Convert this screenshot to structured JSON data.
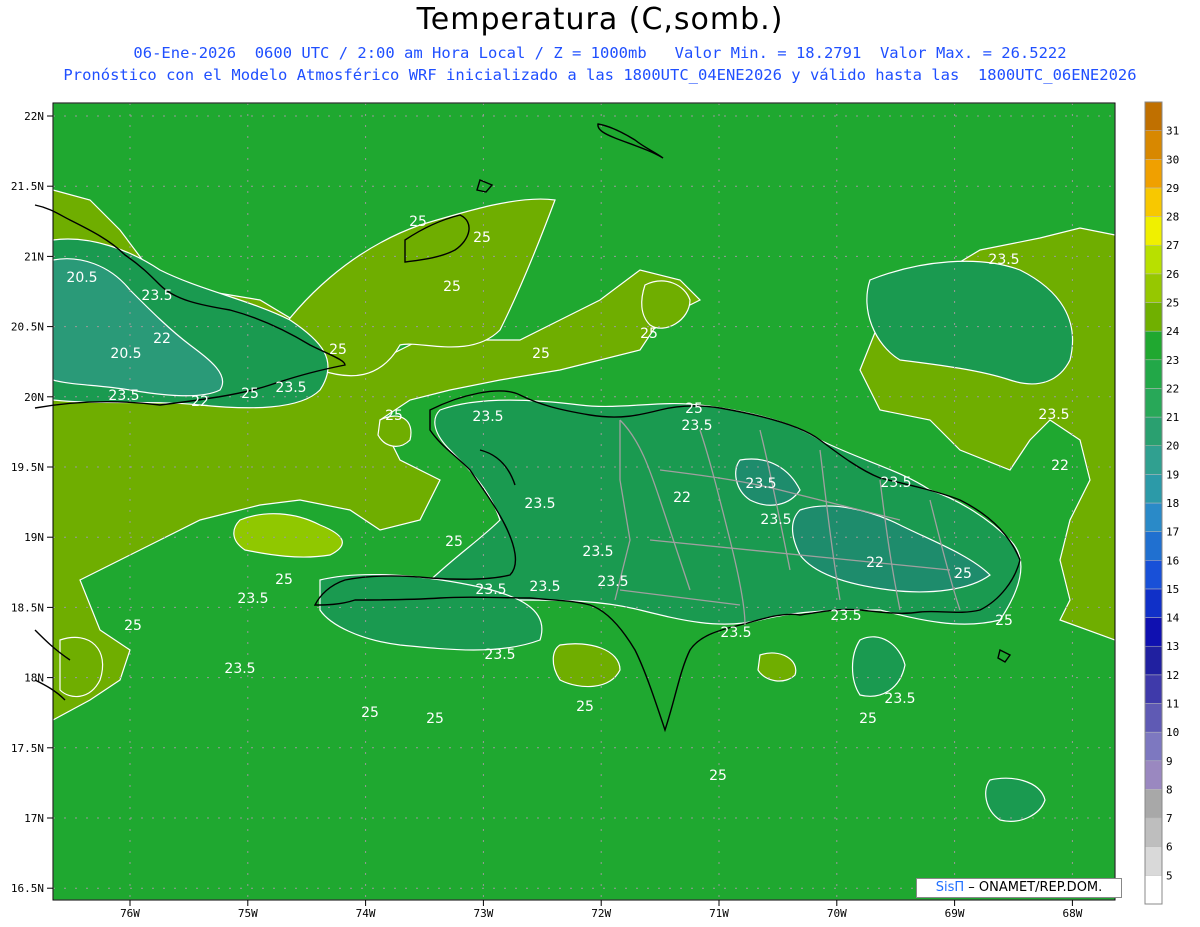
{
  "title": "Temperatura (C,somb.)",
  "subtitle_line1": "06-Ene-2026  0600 UTC / 2:00 am Hora Local / Z = 1000mb   Valor Min. = 18.2791  Valor Max. = 26.5222",
  "subtitle_line2": "Pronóstico con el Modelo Atmosférico WRF inicializado a las 1800UTC_04ENE2026 y válido hasta las  1800UTC_06ENE2026",
  "lat_labels": [
    "22N",
    "21.5N",
    "21N",
    "20.5N",
    "20N",
    "19.5N",
    "19N",
    "18.5N",
    "18N",
    "17.5N",
    "17N",
    "16.5N"
  ],
  "lon_labels": [
    "76W",
    "75W",
    "74W",
    "73W",
    "72W",
    "71W",
    "70W",
    "69W",
    "68W"
  ],
  "colorbar": {
    "levels": [
      "5",
      "6",
      "7",
      "8",
      "9",
      "10",
      "11",
      "12",
      "13",
      "14",
      "15",
      "16",
      "17",
      "18",
      "19",
      "20",
      "21",
      "22",
      "23",
      "24",
      "25",
      "26",
      "27",
      "28",
      "29",
      "30",
      "31"
    ],
    "colors": [
      "#ffffff",
      "#d9d9d9",
      "#bebebe",
      "#a8a8a8",
      "#9a88c0",
      "#7d78c0",
      "#5f5ab4",
      "#3f3aaa",
      "#2020a0",
      "#0f10b0",
      "#1030c8",
      "#1850d8",
      "#2070d0",
      "#2a8ac8",
      "#2c9aa8",
      "#30a090",
      "#2aa070",
      "#28a858",
      "#22a848",
      "#20a830",
      "#70b000",
      "#96c800",
      "#b8e000",
      "#f0f000",
      "#f8c800",
      "#f0a000",
      "#d88800",
      "#c07000"
    ]
  },
  "contour_labels": [
    "25",
    "25",
    "20.5",
    "23.5",
    "25",
    "20.5",
    "22",
    "25",
    "23.5",
    "22",
    "25",
    "23.5",
    "25",
    "25",
    "25",
    "23.5",
    "25",
    "23.5",
    "23.5",
    "22",
    "23.5",
    "23.5",
    "23.5",
    "23.5",
    "23.5",
    "23.5",
    "22",
    "23.5",
    "23.5",
    "22",
    "25",
    "25",
    "23.5",
    "25",
    "23.5",
    "23.5",
    "23.5",
    "23.5",
    "25",
    "23.5",
    "25",
    "25",
    "25",
    "25",
    "23.5",
    "25",
    "25"
  ],
  "credit": {
    "brand": "SisΠ",
    "text": " – ONAMET/REP.DOM."
  }
}
